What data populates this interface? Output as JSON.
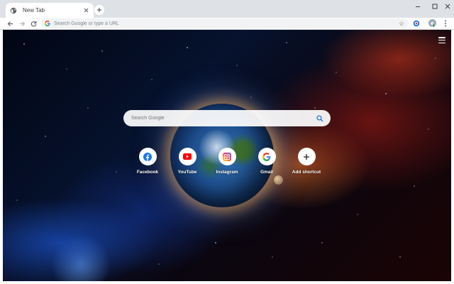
{
  "tab": {
    "title": "New Tab",
    "favicon": "globe-icon",
    "close_icon": "close-icon"
  },
  "window_controls": [
    "minimize-icon",
    "maximize-icon",
    "close-icon"
  ],
  "toolbar": {
    "back_icon": "arrow-left-icon",
    "forward_icon": "arrow-right-icon",
    "reload_icon": "reload-icon",
    "omnibox_placeholder": "Search Google or type a URL",
    "star_icon": "star-icon",
    "extension_icon": "extension-icon",
    "menu_icon": "kebab-menu-icon"
  },
  "newtab_page": {
    "menu_icon": "hamburger-icon",
    "search_placeholder": "Search Google",
    "search_icon": "search-icon",
    "shortcuts": [
      {
        "label": "Facebook",
        "icon": "facebook-icon",
        "color": "#1877f2"
      },
      {
        "label": "YouTube",
        "icon": "youtube-icon",
        "color": "#ff0000"
      },
      {
        "label": "Instagram",
        "icon": "instagram-icon",
        "color": "#d62976"
      },
      {
        "label": "Gmail",
        "icon": "google-icon",
        "color": "#4285f4"
      },
      {
        "label": "Add shortcut",
        "icon": "plus-icon",
        "color": "#202124"
      }
    ]
  }
}
